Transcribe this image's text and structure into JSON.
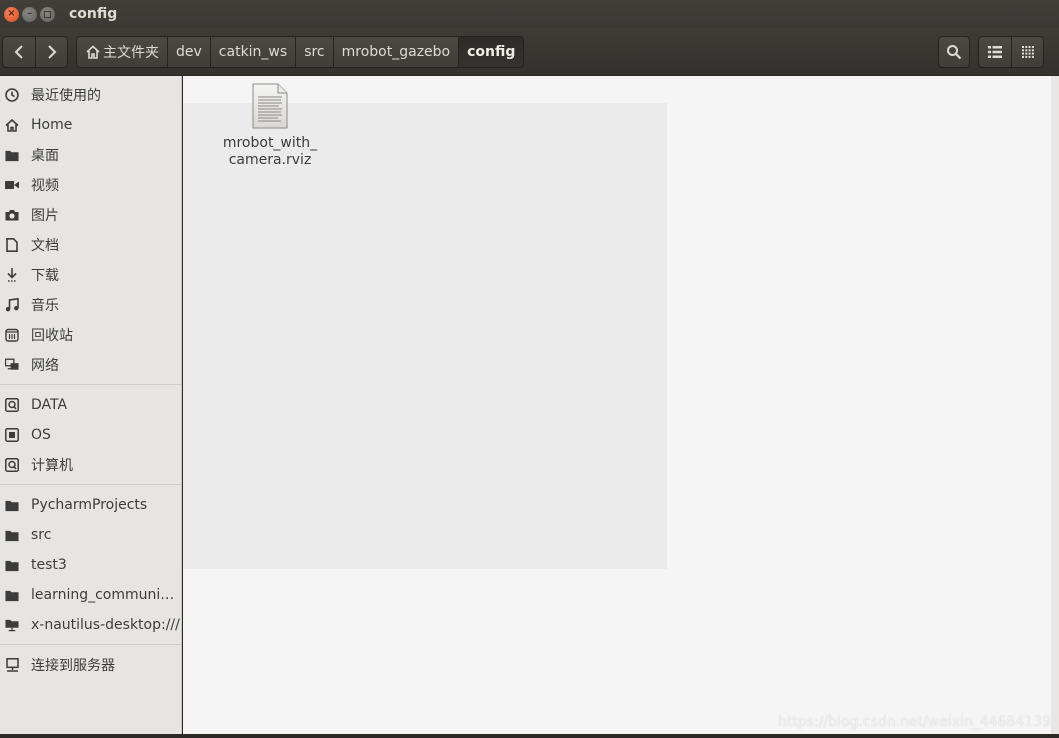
{
  "window": {
    "title": "config"
  },
  "breadcrumbs": [
    {
      "label": "主文件夹",
      "icon": "home-icon"
    },
    {
      "label": "dev"
    },
    {
      "label": "catkin_ws"
    },
    {
      "label": "src"
    },
    {
      "label": "mrobot_gazebo"
    },
    {
      "label": "config",
      "active": true
    }
  ],
  "sidebar": {
    "places": [
      {
        "label": "最近使用的",
        "icon": "recent-icon"
      },
      {
        "label": "Home",
        "icon": "home-icon"
      },
      {
        "label": "桌面",
        "icon": "folder-icon"
      },
      {
        "label": "视频",
        "icon": "video-icon"
      },
      {
        "label": "图片",
        "icon": "camera-icon"
      },
      {
        "label": "文档",
        "icon": "document-icon"
      },
      {
        "label": "下载",
        "icon": "download-icon"
      },
      {
        "label": "音乐",
        "icon": "music-icon"
      },
      {
        "label": "回收站",
        "icon": "trash-icon"
      },
      {
        "label": "网络",
        "icon": "network-icon"
      }
    ],
    "devices": [
      {
        "label": "DATA",
        "icon": "drive-icon"
      },
      {
        "label": "OS",
        "icon": "chip-icon"
      },
      {
        "label": "计算机",
        "icon": "drive-icon"
      }
    ],
    "bookmarks": [
      {
        "label": "PycharmProjects",
        "icon": "folder-icon"
      },
      {
        "label": "src",
        "icon": "folder-icon"
      },
      {
        "label": "test3",
        "icon": "folder-icon"
      },
      {
        "label": "learning_communic...",
        "icon": "folder-icon"
      },
      {
        "label": "x-nautilus-desktop:///",
        "icon": "desktop-icon"
      }
    ],
    "other": [
      {
        "label": "连接到服务器",
        "icon": "server-icon"
      }
    ]
  },
  "files": [
    {
      "name": "mrobot_with_camera.rviz",
      "line1": "mrobot_with_",
      "line2": "camera.rviz",
      "icon": "text-file-icon"
    }
  ],
  "watermark": "https://blog.csdn.net/weixin_44684139"
}
